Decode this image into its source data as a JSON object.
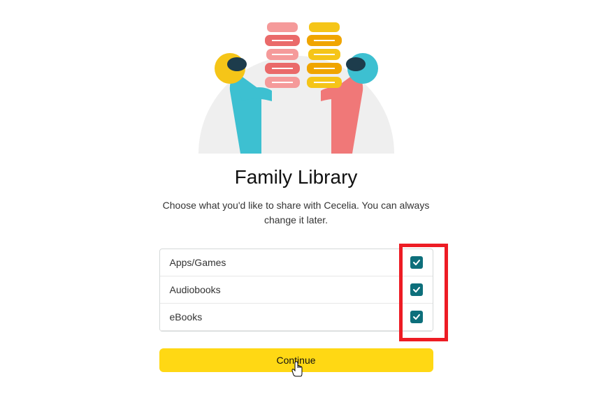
{
  "title": "Family Library",
  "subtitle": "Choose what you'd like to share with Cecelia. You can always change it later.",
  "options": [
    {
      "label": "Apps/Games",
      "checked": true
    },
    {
      "label": "Audiobooks",
      "checked": true
    },
    {
      "label": "eBooks",
      "checked": true
    }
  ],
  "continue_label": "Continue",
  "colors": {
    "button_bg": "#ffd814",
    "checkbox_bg": "#0d6f7b",
    "highlight": "#ed1c24"
  }
}
